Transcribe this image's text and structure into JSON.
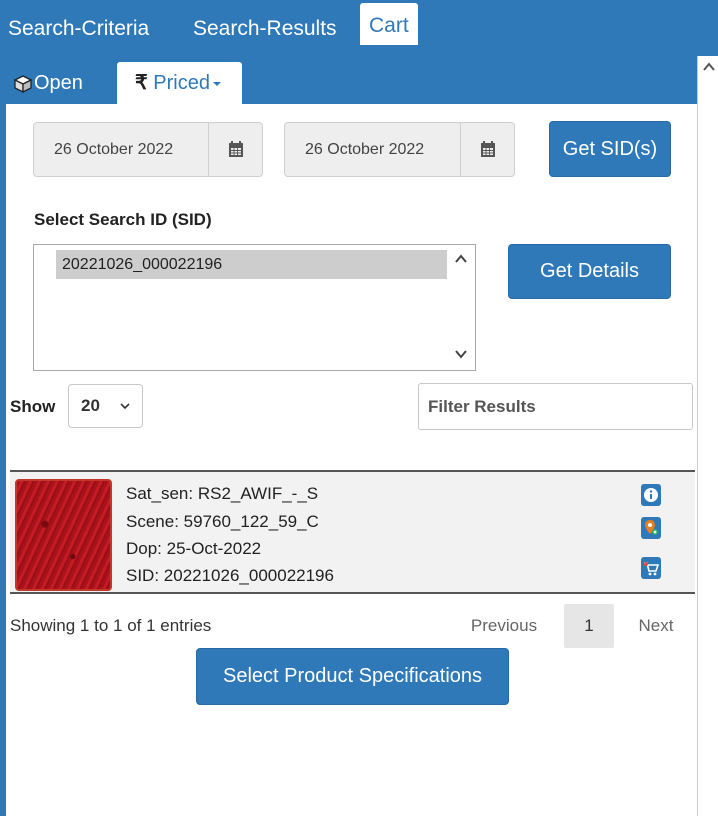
{
  "top_tabs": [
    "Search-Criteria",
    "Search-Results",
    "Cart"
  ],
  "sub_tabs": {
    "open": "Open",
    "priced": "Priced",
    "currency_symbol": "₹"
  },
  "dates": {
    "from": "26 October 2022",
    "to": "26 October 2022"
  },
  "buttons": {
    "get_sids": "Get SID(s)",
    "get_details": "Get Details",
    "select_specs": "Select Product Specifications"
  },
  "sid": {
    "label": "Select Search ID (SID)",
    "options": [
      "20221026_000022196"
    ]
  },
  "table_controls": {
    "show_label": "Show",
    "page_size": "20",
    "filter_placeholder": "Filter Results"
  },
  "results": [
    {
      "sat_sen": "Sat_sen: RS2_AWIF_-_S",
      "scene": "Scene: 59760_122_59_C",
      "dop": "Dop: 25-Oct-2022",
      "sid": "SID: 20221026_000022196"
    }
  ],
  "pagination": {
    "summary": "Showing 1 to 1 of 1 entries",
    "previous": "Previous",
    "current": "1",
    "next": "Next"
  },
  "icons": {
    "calendar": "calendar-icon",
    "info": "info-icon",
    "map_pin": "map-pin-icon",
    "cart": "cart-icon",
    "box": "box-icon",
    "chevron_down": "chevron-down-icon",
    "caret_up": "caret-up-icon"
  },
  "colors": {
    "brand": "#2f79b9",
    "thumb_border": "#c0392b",
    "map_pin": "#e67e22"
  }
}
